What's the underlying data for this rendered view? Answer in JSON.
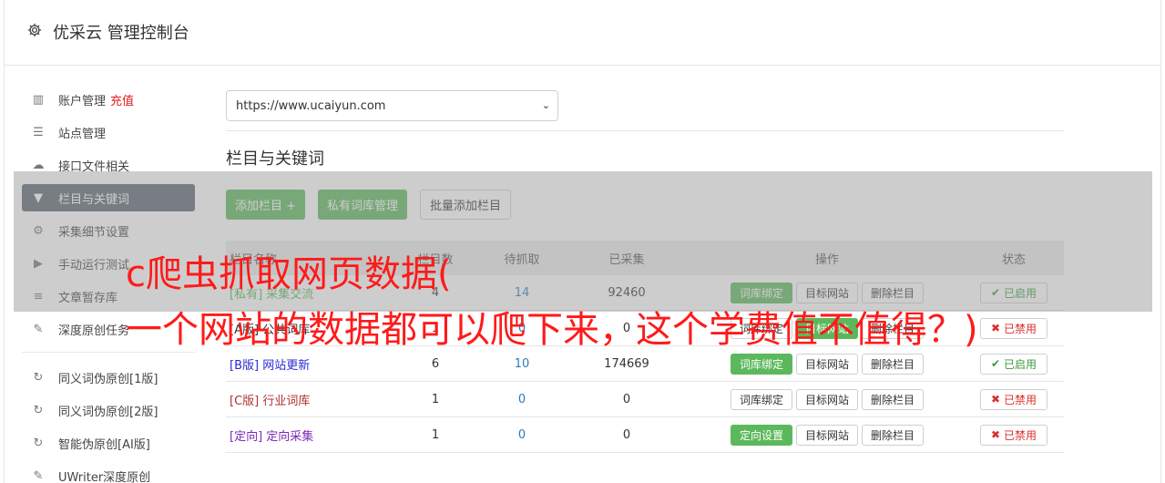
{
  "app": {
    "title": "优采云 管理控制台",
    "icon": "gear-icon"
  },
  "sidebar": {
    "items": [
      {
        "label": "账户管理",
        "extra": "充值",
        "icon": "bar-chart-icon",
        "active": false
      },
      {
        "label": "站点管理",
        "icon": "server-icon",
        "active": false
      },
      {
        "label": "接口文件相关",
        "icon": "cloud-upload-icon",
        "active": false
      },
      {
        "label": "栏目与关键词",
        "icon": "filter-icon",
        "active": true
      },
      {
        "label": "采集细节设置",
        "icon": "cogs-icon",
        "active": false
      },
      {
        "label": "手动运行测试",
        "icon": "play-circle-icon",
        "active": false
      },
      {
        "label": "文章暂存库",
        "icon": "database-icon",
        "active": false
      },
      {
        "label": "深度原创任务",
        "icon": "edit-icon",
        "active": false
      }
    ],
    "items2": [
      {
        "label": "同义词伪原创[1版]",
        "icon": "refresh-icon"
      },
      {
        "label": "同义词伪原创[2版]",
        "icon": "refresh-icon"
      },
      {
        "label": "智能伪原创[AI版]",
        "icon": "refresh-icon"
      },
      {
        "label": "UWriter深度原创",
        "icon": "edit-icon"
      }
    ]
  },
  "site_select": {
    "value": "https://www.ucaiyun.com"
  },
  "section": {
    "title": "栏目与关键词"
  },
  "toolbar": {
    "add_column": "添加栏目 +",
    "private_lexicon": "私有词库管理",
    "batch_add": "批量添加栏目"
  },
  "table": {
    "headers": {
      "name": "栏目名称",
      "a": "栏目数",
      "b": "待抓取",
      "c": "已采集",
      "ops": "操作",
      "status": "状态"
    },
    "rows": [
      {
        "tag": "[私有]",
        "name": "采集交流",
        "color": "#5cb85c",
        "a": "4",
        "b": "14",
        "c": "92460",
        "op1": "词库绑定",
        "op1_green": true,
        "op2": "目标网站",
        "op2_green": false,
        "op3": "删除栏目",
        "status": "已启用",
        "status_on": true
      },
      {
        "tag": "[A版]",
        "name": "公共词库",
        "color": "#333333",
        "a": "1",
        "b": "0",
        "c": "0",
        "op1": "词库绑定",
        "op1_green": false,
        "op2": "目标网站",
        "op2_green": true,
        "op3": "删除栏目",
        "status": "已禁用",
        "status_on": false
      },
      {
        "tag": "[B版]",
        "name": "网站更新",
        "color": "#2a2ad6",
        "a": "6",
        "b": "10",
        "c": "174669",
        "op1": "词库绑定",
        "op1_green": true,
        "op2": "目标网站",
        "op2_green": false,
        "op3": "删除栏目",
        "status": "已启用",
        "status_on": true
      },
      {
        "tag": "[C版]",
        "name": "行业词库",
        "color": "#b03030",
        "a": "1",
        "b": "0",
        "c": "0",
        "op1": "词库绑定",
        "op1_green": false,
        "op2": "目标网站",
        "op2_green": false,
        "op3": "删除栏目",
        "status": "已禁用",
        "status_on": false
      },
      {
        "tag": "[定向]",
        "name": "定向采集",
        "color": "#7a2ab8",
        "a": "1",
        "b": "0",
        "c": "0",
        "op1": "定向设置",
        "op1_green": true,
        "op2": "目标网站",
        "op2_green": false,
        "op3": "删除栏目",
        "status": "已禁用",
        "status_on": false
      }
    ]
  },
  "overlay": {
    "line1": "c爬虫抓取网页数据(",
    "line2": "一个网站的数据都可以爬下来，这个学费值不值得？)"
  }
}
